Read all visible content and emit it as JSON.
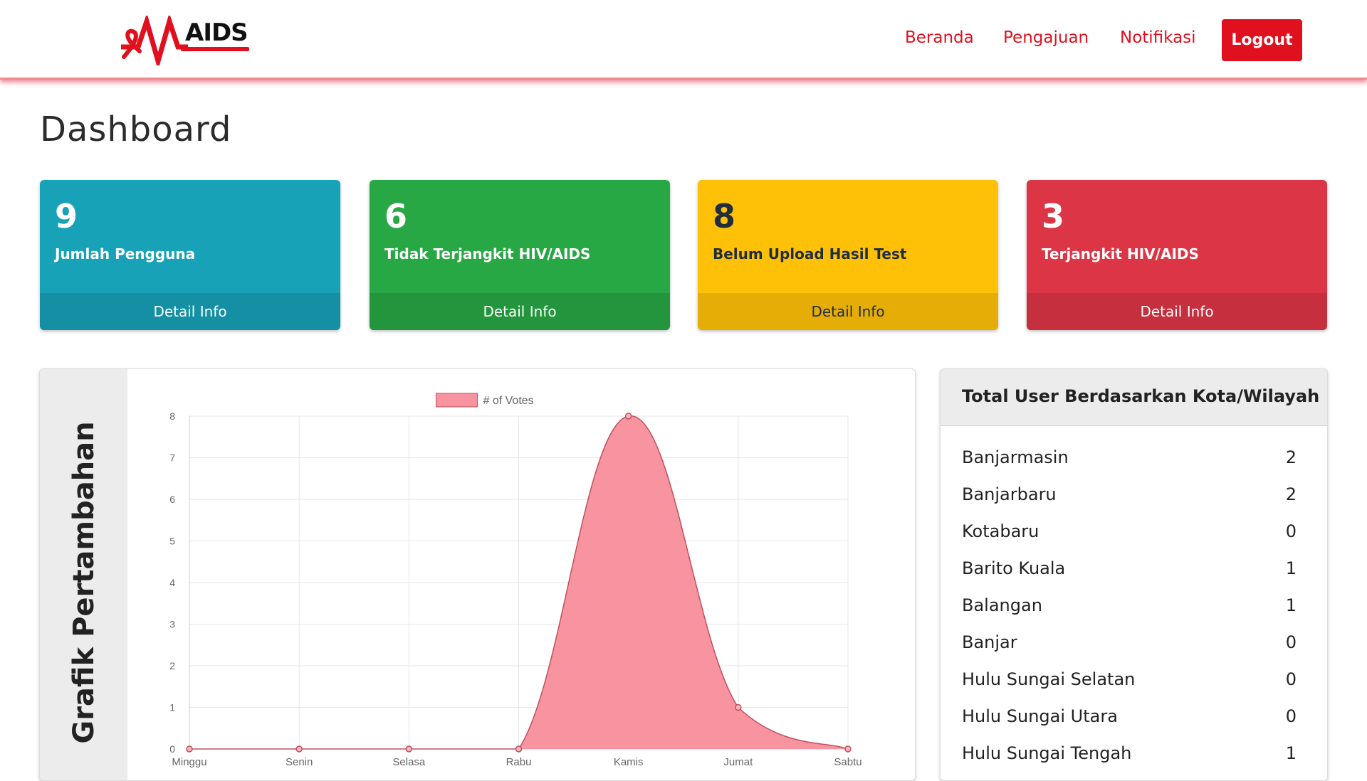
{
  "nav": {
    "logo_text": "AIDS",
    "links": [
      "Beranda",
      "Pengajuan",
      "Notifikasi"
    ],
    "logout_label": "Logout"
  },
  "page_title": "Dashboard",
  "cards": [
    {
      "value": "9",
      "label": "Jumlah Pengguna",
      "footer": "Detail Info",
      "color": "#17a2b8"
    },
    {
      "value": "6",
      "label": "Tidak Terjangkit HIV/AIDS",
      "footer": "Detail Info",
      "color": "#28a745"
    },
    {
      "value": "8",
      "label": "Belum Upload Hasil Test",
      "footer": "Detail Info",
      "color": "#ffc107"
    },
    {
      "value": "3",
      "label": "Terjangkit HIV/AIDS",
      "footer": "Detail Info",
      "color": "#dc3545"
    }
  ],
  "chart_panel": {
    "side_title": "Grafik Pertambahan"
  },
  "chart_data": {
    "type": "area",
    "categories": [
      "Minggu",
      "Senin",
      "Selasa",
      "Rabu",
      "Kamis",
      "Jumat",
      "Sabtu"
    ],
    "series": [
      {
        "name": "# of Votes",
        "values": [
          0,
          0,
          0,
          0,
          8,
          1,
          0
        ]
      }
    ],
    "ylim": [
      0,
      8
    ],
    "yticks": [
      0,
      1,
      2,
      3,
      4,
      5,
      6,
      7,
      8
    ],
    "grid": true,
    "legend": "top-center",
    "fill_color": "#f8949f",
    "line_color": "#c0505e"
  },
  "city_panel": {
    "title": "Total User Berdasarkan Kota/Wilayah",
    "rows": [
      {
        "name": "Banjarmasin",
        "count": "2"
      },
      {
        "name": "Banjarbaru",
        "count": "2"
      },
      {
        "name": "Kotabaru",
        "count": "0"
      },
      {
        "name": "Barito Kuala",
        "count": "1"
      },
      {
        "name": "Balangan",
        "count": "1"
      },
      {
        "name": "Banjar",
        "count": "0"
      },
      {
        "name": "Hulu Sungai Selatan",
        "count": "0"
      },
      {
        "name": "Hulu Sungai Utara",
        "count": "0"
      },
      {
        "name": "Hulu Sungai Tengah",
        "count": "1"
      }
    ]
  },
  "colors": {
    "brand": "#e0101e",
    "text": "#222222"
  }
}
